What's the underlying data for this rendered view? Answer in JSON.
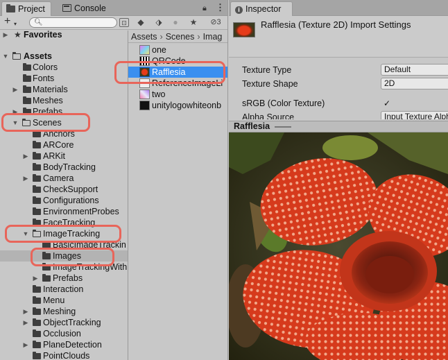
{
  "project": {
    "tabs": [
      {
        "label": "Project",
        "icon": "folder-icon"
      },
      {
        "label": "Console",
        "icon": "console-icon"
      }
    ],
    "hidden_count": "3",
    "tree": [
      {
        "label": "Favorites",
        "level": 0,
        "arrow": "▶",
        "bold": true,
        "icon": "star-icon"
      },
      {
        "label": "Assets",
        "level": 0,
        "arrow": "▼",
        "bold": true,
        "icon": "folder-open-icon"
      },
      {
        "label": "Colors",
        "level": 1,
        "arrow": ""
      },
      {
        "label": "Fonts",
        "level": 1,
        "arrow": ""
      },
      {
        "label": "Materials",
        "level": 1,
        "arrow": "▶"
      },
      {
        "label": "Meshes",
        "level": 1,
        "arrow": ""
      },
      {
        "label": "Prefabs",
        "level": 1,
        "arrow": ""
      },
      {
        "label": "Scenes",
        "level": 0,
        "arrow": "▼",
        "open": true
      },
      {
        "label": "Anchors",
        "level": 2,
        "arrow": ""
      },
      {
        "label": "ARCore",
        "level": 2,
        "arrow": ""
      },
      {
        "label": "ARKit",
        "level": 2,
        "arrow": "▶"
      },
      {
        "label": "BodyTracking",
        "level": 2,
        "arrow": ""
      },
      {
        "label": "Camera",
        "level": 2,
        "arrow": "▶"
      },
      {
        "label": "CheckSupport",
        "level": 2,
        "arrow": ""
      },
      {
        "label": "Configurations",
        "level": 2,
        "arrow": ""
      },
      {
        "label": "EnvironmentProbes",
        "level": 2,
        "arrow": ""
      },
      {
        "label": "FaceTracking",
        "level": 2,
        "arrow": ""
      },
      {
        "label": "ImageTracking",
        "level": 2,
        "arrow": "▼",
        "open": true
      },
      {
        "label": "BasicImageTrackin",
        "level": 3,
        "arrow": ""
      },
      {
        "label": "Images",
        "level": 3,
        "arrow": "",
        "selected": true
      },
      {
        "label": "ImageTrackingWith",
        "level": 3,
        "arrow": ""
      },
      {
        "label": "Prefabs",
        "level": 3,
        "arrow": "▶"
      },
      {
        "label": "Interaction",
        "level": 2,
        "arrow": ""
      },
      {
        "label": "Menu",
        "level": 2,
        "arrow": ""
      },
      {
        "label": "Meshing",
        "level": 2,
        "arrow": "▶"
      },
      {
        "label": "ObjectTracking",
        "level": 2,
        "arrow": "▶"
      },
      {
        "label": "Occlusion",
        "level": 2,
        "arrow": ""
      },
      {
        "label": "PlaneDetection",
        "level": 2,
        "arrow": "▶"
      },
      {
        "label": "PointClouds",
        "level": 2,
        "arrow": ""
      }
    ],
    "breadcrumb": [
      "Assets",
      "Scenes",
      "Imag"
    ],
    "files": [
      {
        "label": "one",
        "thumb": "one"
      },
      {
        "label": "QRCode",
        "thumb": "qr"
      },
      {
        "label": "Rafflesia",
        "thumb": "rafflesia",
        "selected": true
      },
      {
        "label": "ReferenceImageLi",
        "thumb": "ref"
      },
      {
        "label": "two",
        "thumb": "two"
      },
      {
        "label": "unitylogowhiteonb",
        "thumb": "logo"
      }
    ]
  },
  "inspector": {
    "tab_label": "Inspector",
    "title": "Rafflesia (Texture 2D) Import Settings",
    "properties": [
      {
        "label": "Texture Type",
        "value": "Default"
      },
      {
        "label": "Texture Shape",
        "value": "2D"
      },
      {
        "label": "sRGB (Color Texture)",
        "value": "✓",
        "checkbox": true
      },
      {
        "label": "Alpha Source",
        "value": "Input Texture Alpha"
      }
    ],
    "preview_title": "Rafflesia"
  },
  "colors": {
    "selection": "#3a8ff0",
    "highlight": "#e8655a"
  }
}
